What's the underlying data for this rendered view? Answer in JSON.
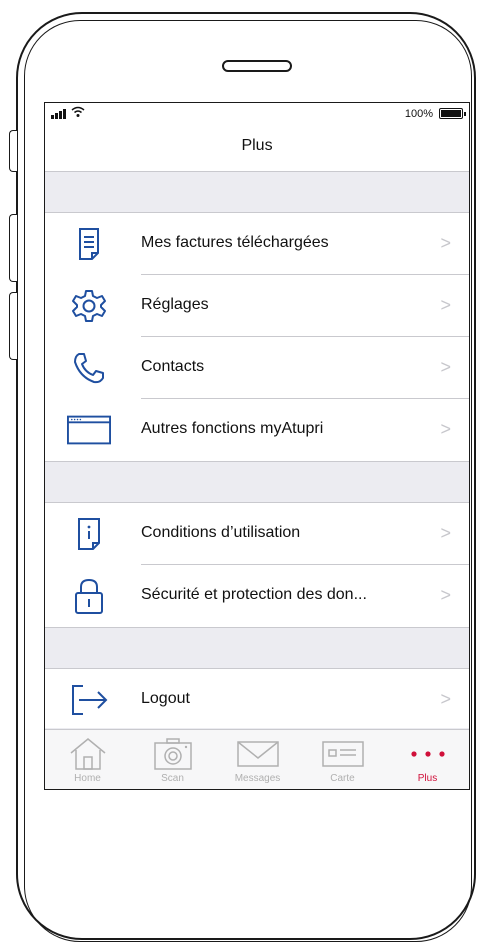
{
  "status_bar": {
    "battery_text": "100%"
  },
  "nav": {
    "title": "Plus"
  },
  "sections": [
    {
      "items": [
        {
          "label": "Mes factures téléchargées",
          "icon": "invoice-icon"
        },
        {
          "label": "Réglages",
          "icon": "gear-icon"
        },
        {
          "label": "Contacts",
          "icon": "phone-icon"
        },
        {
          "label": "Autres fonctions myAtupri",
          "icon": "browser-window-icon"
        }
      ]
    },
    {
      "items": [
        {
          "label": "Conditions d’utilisation",
          "icon": "info-document-icon"
        },
        {
          "label": "Sécurité et protection des don...",
          "icon": "lock-icon"
        }
      ]
    },
    {
      "items": [
        {
          "label": "Logout",
          "icon": "logout-icon"
        }
      ]
    }
  ],
  "tabbar": {
    "tabs": [
      {
        "label": "Home",
        "icon": "home-icon"
      },
      {
        "label": "Scan",
        "icon": "camera-icon"
      },
      {
        "label": "Messages",
        "icon": "envelope-icon"
      },
      {
        "label": "Carte",
        "icon": "card-icon"
      },
      {
        "label": "Plus",
        "icon": "more-dots-icon",
        "active": true
      }
    ]
  },
  "colors": {
    "accent": "#d0103a",
    "icon_blue": "#1f4fa0",
    "group_background": "#ececf1",
    "tab_inactive": "#b0b0b0"
  }
}
